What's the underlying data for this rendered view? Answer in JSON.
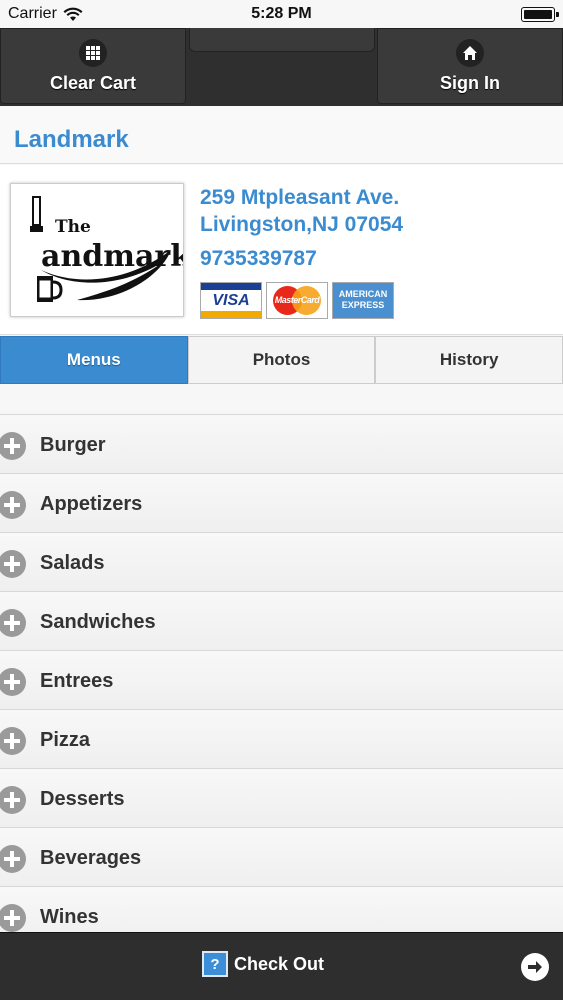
{
  "status_bar": {
    "carrier": "Carrier",
    "time": "5:28 PM"
  },
  "toolbar": {
    "clear_cart_label": "Clear Cart",
    "sign_in_label": "Sign In"
  },
  "restaurant": {
    "name": "Landmark",
    "logo_text_the": "The",
    "logo_text_name": "andmark",
    "address_line1": "259 Mtpleasant Ave.",
    "address_line2": "Livingston,NJ 07054",
    "phone": "9735339787",
    "cards": [
      "VISA",
      "MasterCard",
      "AMERICAN EXPRESS"
    ]
  },
  "tabs": [
    {
      "label": "Menus",
      "active": true
    },
    {
      "label": "Photos",
      "active": false
    },
    {
      "label": "History",
      "active": false
    }
  ],
  "menu_categories": [
    "Burger",
    "Appetizers",
    "Salads",
    "Sandwiches",
    "Entrees",
    "Pizza",
    "Desserts",
    "Beverages",
    "Wines"
  ],
  "footer": {
    "checkout_label": "Check Out",
    "help_glyph": "?"
  },
  "colors": {
    "accent": "#3a8bd0",
    "toolbar": "#2f2f2f"
  }
}
